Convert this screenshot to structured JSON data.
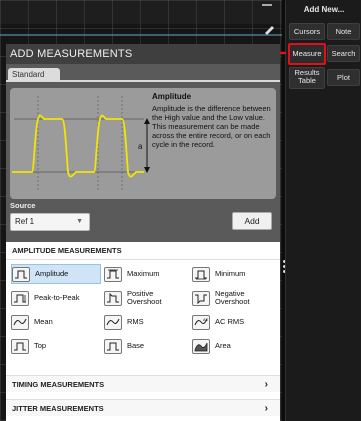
{
  "right_panel": {
    "title": "Add New...",
    "buttons": [
      {
        "id": "cursors",
        "label": "Cursors"
      },
      {
        "id": "note",
        "label": "Note"
      },
      {
        "id": "measure",
        "label": "Measure"
      },
      {
        "id": "search",
        "label": "Search"
      },
      {
        "id": "results_table",
        "label": "Results Table"
      },
      {
        "id": "plot",
        "label": "Plot"
      }
    ]
  },
  "dialog": {
    "title": "ADD MEASUREMENTS",
    "tab": "Standard",
    "preview": {
      "title": "Amplitude",
      "description": "Amplitude is the difference between the High value and the Low value. This measurement can be made across the entire record, or on each cycle in the record.",
      "marker_a": "a"
    },
    "source": {
      "label": "Source",
      "value": "Ref 1"
    },
    "add_label": "Add",
    "amplitude_section": {
      "header": "AMPLITUDE MEASUREMENTS",
      "items": [
        {
          "label": "Amplitude",
          "icon": "amplitude-icon",
          "selected": true
        },
        {
          "label": "Maximum",
          "icon": "maximum-icon"
        },
        {
          "label": "Minimum",
          "icon": "minimum-icon"
        },
        {
          "label": "Peak-to-Peak",
          "icon": "peak-to-peak-icon"
        },
        {
          "label": "Positive Overshoot",
          "icon": "positive-overshoot-icon"
        },
        {
          "label": "Negative Overshoot",
          "icon": "negative-overshoot-icon"
        },
        {
          "label": "Mean",
          "icon": "mean-icon"
        },
        {
          "label": "RMS",
          "icon": "rms-icon"
        },
        {
          "label": "AC RMS",
          "icon": "ac-rms-icon"
        },
        {
          "label": "Top",
          "icon": "top-icon"
        },
        {
          "label": "Base",
          "icon": "base-icon"
        },
        {
          "label": "Area",
          "icon": "area-icon"
        }
      ]
    },
    "categories": [
      {
        "label": "TIMING MEASUREMENTS"
      },
      {
        "label": "JITTER MEASUREMENTS"
      }
    ]
  },
  "colors": {
    "accent_highlight": "#e0111a",
    "waveform": "#f2e600",
    "selected_bg": "#cfe4f7"
  }
}
